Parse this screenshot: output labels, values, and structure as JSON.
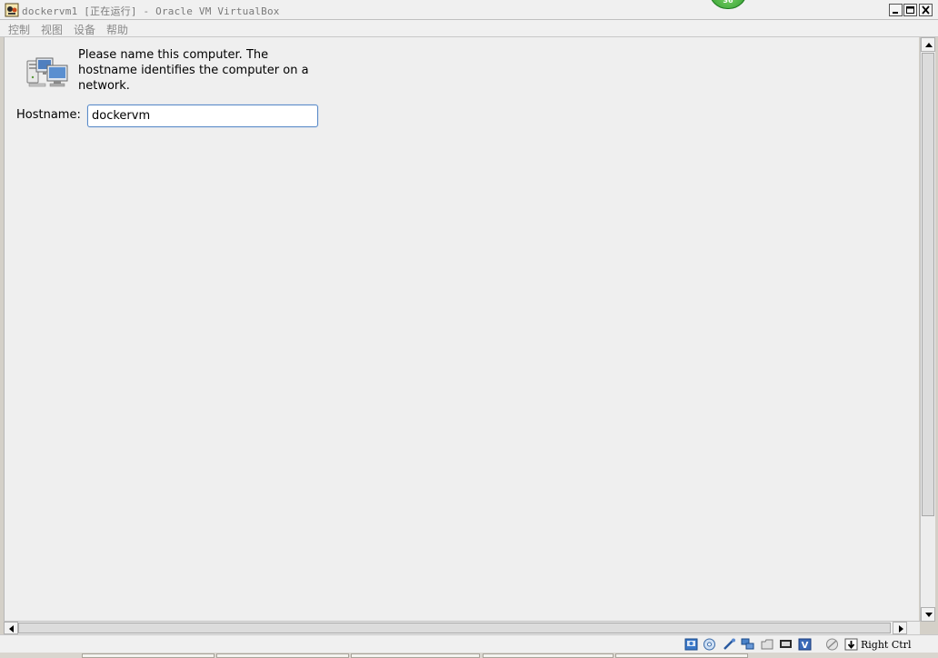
{
  "window": {
    "title": "dockervm1 [正在运行] - Oracle VM VirtualBox",
    "badge_text": "36"
  },
  "menu": {
    "items": [
      {
        "label": "控制"
      },
      {
        "label": "视图"
      },
      {
        "label": "设备"
      },
      {
        "label": "帮助"
      }
    ]
  },
  "installer": {
    "prompt": "Please name this computer.  The hostname identifies the computer on a network.",
    "hostname_label": "Hostname:",
    "hostname_value": "dockervm"
  },
  "statusbar": {
    "icons": [
      "hard-disk-icon",
      "optical-drive-icon",
      "usb-icon",
      "network-icon",
      "shared-folders-icon",
      "display-icon",
      "virtualization-icon",
      "mouse-integration-icon",
      "host-key-arrow-icon"
    ],
    "host_key": "Right Ctrl"
  },
  "colors": {
    "input_border": "#5b8bc8",
    "screen_bg": "#efefef",
    "menu_text": "#8a8a8a"
  }
}
